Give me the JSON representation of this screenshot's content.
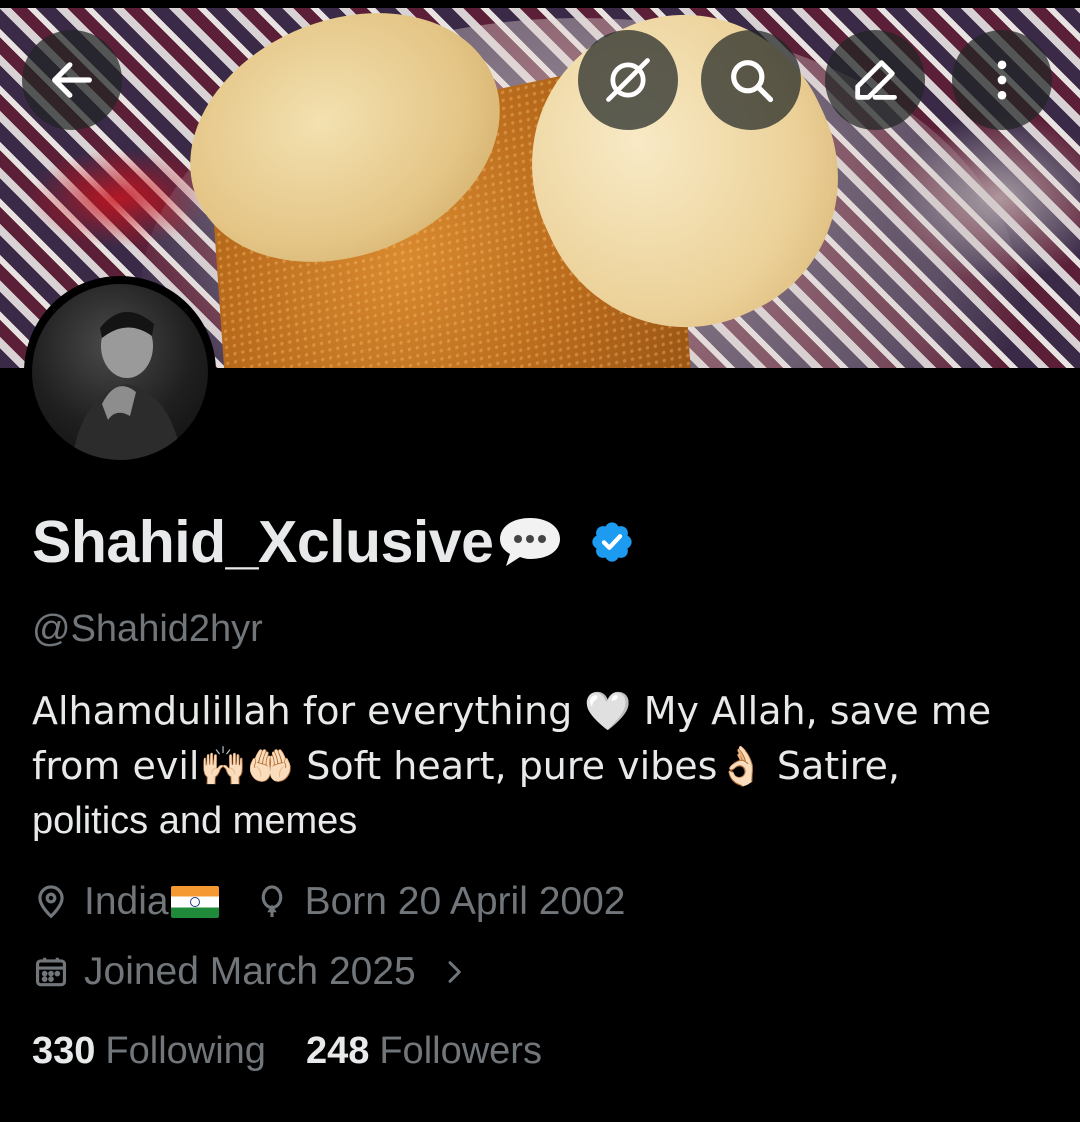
{
  "header": {
    "back_icon": "arrow-left-icon",
    "actions": [
      "spaces-icon",
      "search-icon",
      "edit-icon",
      "more-icon"
    ]
  },
  "profile": {
    "display_name": "Shahid_Xclusive",
    "handle": "@Shahid2hyr",
    "verified": true,
    "verified_color": "#1d9bf0",
    "bio_line1": "Alhamdulillah for everything 🤍 My Allah, save me",
    "bio_line2": "from evil🙌🏻🤲🏻  Soft heart, pure vibes👌🏻  Satire,",
    "bio_line3": "politics and memes",
    "location": "India",
    "birthday": "Born 20 April 2002",
    "joined": "Joined March 2025",
    "following_count": "330",
    "following_label": "Following",
    "followers_count": "248",
    "followers_label": "Followers"
  },
  "colors": {
    "background": "#000000",
    "text_primary": "#e7e9ea",
    "text_secondary": "#71767b"
  }
}
